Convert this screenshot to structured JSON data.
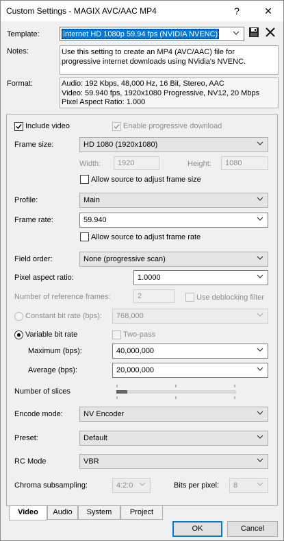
{
  "window": {
    "title": "Custom Settings - MAGIX AVC/AAC MP4",
    "help_glyph": "?",
    "close_glyph": "✕"
  },
  "header": {
    "template_label": "Template:",
    "template_value": "Internet HD 1080p 59.94 fps (NVIDIA NVENC)",
    "notes_label": "Notes:",
    "notes_line1": "Use this setting to create an MP4 (AVC/AAC) file for",
    "notes_line2": "progressive internet downloads using NVidia's NVENC.",
    "format_label": "Format:",
    "format_line1": "Audio: 192 Kbps, 48,000 Hz, 16 Bit, Stereo, AAC",
    "format_line2": "Video: 59.940 fps, 1920x1080 Progressive, NV12, 20 Mbps",
    "format_line3": "Pixel Aspect Ratio: 1.000"
  },
  "video": {
    "include_video": "Include video",
    "include_video_checked": true,
    "enable_progressive": "Enable progressive download",
    "enable_progressive_checked": true,
    "frame_size_label": "Frame size:",
    "frame_size_value": "HD 1080 (1920x1080)",
    "width_label": "Width:",
    "width_value": "1920",
    "height_label": "Height:",
    "height_value": "1080",
    "allow_frame_size": "Allow source to adjust frame size",
    "profile_label": "Profile:",
    "profile_value": "Main",
    "frame_rate_label": "Frame rate:",
    "frame_rate_value": "59.940",
    "allow_frame_rate": "Allow source to adjust frame rate",
    "field_order_label": "Field order:",
    "field_order_value": "None (progressive scan)",
    "par_label": "Pixel aspect ratio:",
    "par_value": "1.0000",
    "ref_frames_label": "Number of reference frames:",
    "ref_frames_value": "2",
    "deblocking": "Use deblocking filter",
    "cbr_label": "Constant bit rate (bps):",
    "cbr_value": "768,000",
    "vbr_label": "Variable bit rate",
    "two_pass": "Two-pass",
    "max_label": "Maximum (bps):",
    "max_value": "40,000,000",
    "avg_label": "Average (bps):",
    "avg_value": "20,000,000",
    "slices_label": "Number of slices",
    "slices_level": 0,
    "encode_mode_label": "Encode mode:",
    "encode_mode_value": "NV Encoder",
    "preset_label": "Preset:",
    "preset_value": "Default",
    "rc_mode_label": "RC Mode",
    "rc_mode_value": "VBR",
    "chroma_label": "Chroma subsampling:",
    "chroma_value": "4:2:0",
    "bpp_label": "Bits per pixel:",
    "bpp_value": "8"
  },
  "tabs": [
    "Video",
    "Audio",
    "System",
    "Project"
  ],
  "buttons": {
    "ok": "OK",
    "cancel": "Cancel"
  },
  "colors": {
    "selection": "#0078d7",
    "accent": "#0078d7"
  }
}
